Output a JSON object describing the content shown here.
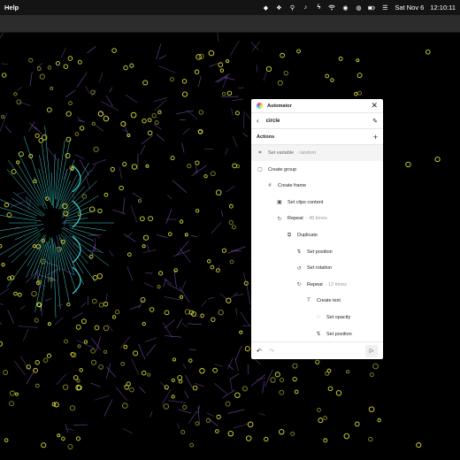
{
  "menubar": {
    "app_menu": "Help",
    "date": "Sat Nov 6",
    "time": "12:10:11",
    "icons": [
      "figma-icon",
      "dropbox-icon",
      "search-icon",
      "sound-icon",
      "flash-icon",
      "wifi-icon",
      "control-center-icon",
      "siri-icon",
      "battery-icon",
      "control-icon"
    ]
  },
  "panel": {
    "title": "Automator",
    "shortcut_name": "circle",
    "actions_label": "Actions",
    "steps": [
      {
        "label": "Set variable",
        "detail": "· random",
        "icon": "variable-icon"
      },
      {
        "label": "Create group",
        "detail": "",
        "icon": "group-icon"
      },
      {
        "label": "Create frame",
        "detail": "",
        "icon": "frame-icon"
      },
      {
        "label": "Set clips content",
        "detail": "",
        "icon": "clip-icon"
      },
      {
        "label": "Repeat",
        "detail": "· 48 times",
        "icon": "repeat-icon"
      },
      {
        "label": "Duplicate",
        "detail": "",
        "icon": "duplicate-icon"
      },
      {
        "label": "Set position",
        "detail": "",
        "icon": "position-icon"
      },
      {
        "label": "Set rotation",
        "detail": "",
        "icon": "rotation-icon"
      },
      {
        "label": "Repeat",
        "detail": "· 12 times",
        "icon": "repeat-icon"
      },
      {
        "label": "Create text",
        "detail": "",
        "icon": "text-icon"
      },
      {
        "label": "Set opacity",
        "detail": "",
        "icon": "opacity-icon"
      },
      {
        "label": "Set position",
        "detail": "",
        "icon": "position-icon"
      }
    ]
  },
  "colors": {
    "dot_yellow": "#d7d83a",
    "dot_olive": "#8a8a2a",
    "line_purple": "#8b5cc4",
    "line_cyan": "#3fd6d6",
    "panel_bg": "#ffffff"
  }
}
